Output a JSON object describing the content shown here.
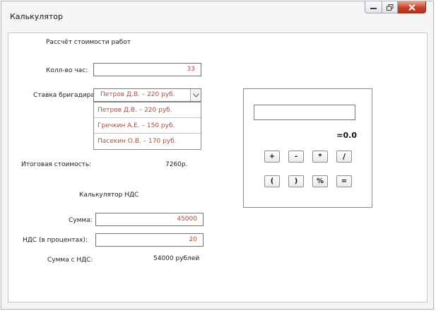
{
  "window": {
    "title": "Калькулятор",
    "controls": {
      "minimize_icon": "minimize-icon",
      "maximize_icon": "restore-icon",
      "close_icon": "close-icon"
    }
  },
  "work": {
    "heading": "Рассчёт стоимости работ",
    "hours_label": "Колл-во час:",
    "hours_value": "33",
    "rate_label": "Ставка бригадира:",
    "rate_selected": "Петров Д.В. – 220 руб.",
    "rate_options": [
      "Петров Д.В. – 220 руб.",
      "Гречкин А.Е. – 150 руб.",
      "Пасекин О.В. – 170 руб."
    ],
    "total_label": "Итоговая стоимость:",
    "total_value": "7260р."
  },
  "vat": {
    "heading": "Калькулятор НДС",
    "sum_label": "Сумма:",
    "sum_value": "45000",
    "percent_label": "НДС (в процентах):",
    "percent_value": "20",
    "result_label": "Сумма с НДС:",
    "result_value": "54000 рублей"
  },
  "calculator": {
    "display_value": "",
    "result": "=0.0",
    "row1": [
      "+",
      "-",
      "*",
      "/"
    ],
    "row2": [
      "(",
      ")",
      "%",
      "="
    ]
  },
  "colors": {
    "value_text": "#b04a37",
    "close_button": "#c7432a"
  }
}
